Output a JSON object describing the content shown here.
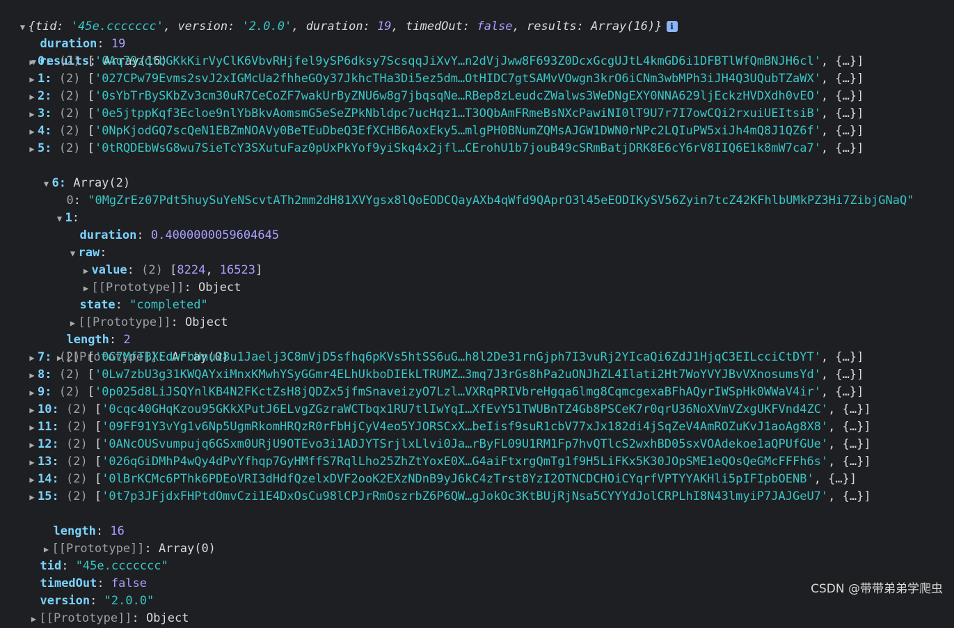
{
  "summary": {
    "tid": "'45e.ccccccc'",
    "version": "'2.0.0'",
    "duration": "19",
    "timedOut": "false",
    "results": "Array(16)"
  },
  "root": {
    "duration": "19",
    "results_label": "Array(16)"
  },
  "rows": [
    {
      "idx": "0",
      "str": "'0Aq79zqtbGKkKirVyClK6VbvRHjfel9ySP6dksy7ScsqqJiXvY…n2dVjJww8F693Z0DcxGcgUJtL4kmGD6i1DFBTlWfQmBNJH6cl'"
    },
    {
      "idx": "1",
      "str": "'027CPw79Evms2svJ2xIGMcUa2fhheGOy37JkhcTHa3Di5ez5dm…OtHIDC7gtSAMvVOwgn3krO6iCNm3wbMPh3iJH4Q3UQubTZaWX'"
    },
    {
      "idx": "2",
      "str": "'0sYbTrBySKbZv3cm30uR7CeCoZF7wakUrByZNU6w8g7jbqsqNe…RBep8zLeudcZWalws3WeDNgEXY0NNA629ljEckzHVDXdh0vEO'"
    },
    {
      "idx": "3",
      "str": "'0e5jtppKqf3Ecloe9nlYbBkvAomsmG5eSeZPkNbldpc7ucHqz1…T3OQbAmFRmeBsNXcPawiNI0lT9U7r7I7owCQi2rxuiUEItsiB'"
    },
    {
      "idx": "4",
      "str": "'0NpKjodGQ7scQeN1EBZmNOAVy0BeTEuDbeQ3EfXCHB6AoxEky5…mlgPH0BNumZQMsAJGW1DWN0rNPc2LQIuPW5xiJh4mQ8J1QZ6f'"
    },
    {
      "idx": "5",
      "str": "'0tRQDEbWsG8wu7SieTcY3SXutuFaz0pUxPkYof9yiSkq4x2jfl…CErohU1b7jouB49cSRmBatjDRK8E6cY6rV8IIQ6E1k8mW7ca7'"
    }
  ],
  "row6": {
    "idx": "6",
    "label": "Array(2)",
    "item0": "\"0MgZrEz07Pdt5huySuYeNScvtATh2mm2dH81XVYgsx8lQoEODCQayAXb4qWfd9QAprO3l45eEODIKySV56Zyin7tcZ42KFhlbUMkPZ3Hi7ZibjGNaQ\"",
    "duration": "0.4000000059604645",
    "value_a": "8224",
    "value_b": "16523",
    "state": "\"completed\"",
    "length": "2"
  },
  "rows2": [
    {
      "idx": "7",
      "str": "'0G7MfTBXEdwFbUnu28u1Jaelj3C8mVjD5sfhq6pKVs5htSS6uG…h8l2De31rnGjph7I3vuRj2YIcaQi6ZdJ1HjqC3EILcciCtDYT'"
    },
    {
      "idx": "8",
      "str": "'0Lw7zbU3g31KWQAYxiMnxKMwhYSyGGmr4ELhUkboDIEkLTRUMZ…3mq7J3rGs8hPa2uONJhZL4Ilati2Ht7WoYVYJBvVXnosumsYd'"
    },
    {
      "idx": "9",
      "str": "'0p025d8LiJSQYnlKB4N2FKctZsH8jQDZx5jfmSnaveizyO7Lzl…VXRqPRIVbreHgqa6lmg8CqmcgexaBFhAQyrIWSpHk0WWaV4ir'"
    },
    {
      "idx": "10",
      "str": "'0cqc40GHqKzou95GKkXPutJ6ELvgZGzraWCTbqx1RU7tlIwYqI…XfEvY51TWUBnTZ4Gb8PSCeK7r0qrU36NoXVmVZxgUKFVnd4ZC'"
    },
    {
      "idx": "11",
      "str": "'09FF91Y3vYg1v6Np5UgmRkomHRQzR0rFbHjCyV4eo5YJORSCxX…beIisf9suR1cbV77xJx182di4jSqZeV4AmROZuKvJ1aoAg8X8'"
    },
    {
      "idx": "12",
      "str": "'0ANcOUSvumpujq6GSxm0URjU9OTEvo3i1ADJYTSrjlxLlvi0Ja…rByFL09U1RM1Fp7hvQTlcS2wxhBD05sxVOAdekoe1aQPUfGUe'"
    },
    {
      "idx": "13",
      "str": "'026qGiDMhP4wQy4dPvYfhqp7GyHMffS7RqlLho25ZhZtYoxE0X…G4aiFtxrgQmTg1f9H5LiFKx5K30JOpSME1eQOsQeGMcFFFh6s'"
    },
    {
      "idx": "14",
      "str": "'0lBrKCMc6PThk6PDEoVRI3dHdfQzelxDVF2ooK2EXzNDnB9yJ6kC4zTrst8YzI2OTNCDCHOiCYqrfVPTYYAKHli5pIFIpbOENB'"
    },
    {
      "idx": "15",
      "str": "'0t7p3JFjdxFHPtdOmvCzi1E4DxOsCu98lCPJrRmOszrbZ6P6QW…gJokOc3KtBUjRjNsa5CYYYdJolCRPLhI8N43lmyiP7JAJGeU7'"
    }
  ],
  "labels": {
    "length": "16",
    "tid": "\"45e.ccccccc\"",
    "timedOut": "false",
    "version": "\"2.0.0\"",
    "proto_object": "Object",
    "proto_array0": "Array(0)",
    "ellipsis_obj": "{…}",
    "count2": "(2)"
  },
  "watermark": "CSDN @带带弟弟学爬虫",
  "colors": {
    "background": "#1e1f22",
    "key": "#7ad3ff",
    "number": "#a6a0ff",
    "string": "#39c5c7"
  }
}
